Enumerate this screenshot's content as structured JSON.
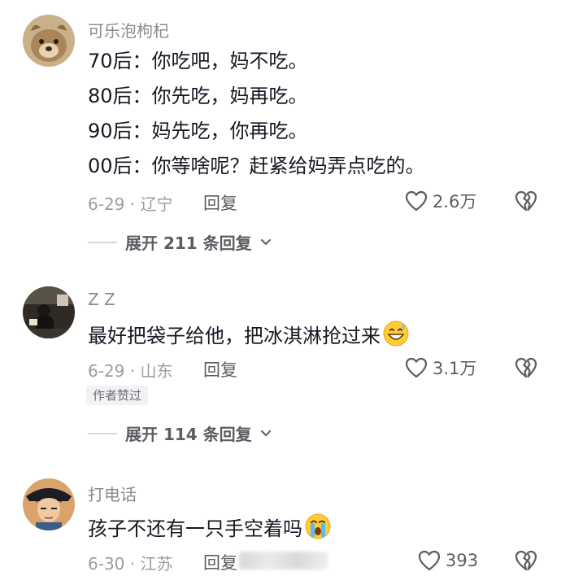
{
  "comments": [
    {
      "username": "可乐泡枸杞",
      "avatar_icon": "dog-photo-avatar",
      "lines": [
        "70后：你吃吧，妈不吃。",
        "80后：你先吃，妈再吃。",
        "90后：妈先吃，你再吃。",
        "00后：你等啥呢？赶紧给妈弄点吃的。"
      ],
      "date_location": "6-29 · 辽宁",
      "reply_label": "回复",
      "like_count": "2.6万",
      "expand_label": "展开 211 条回复"
    },
    {
      "username": "Z Z",
      "avatar_icon": "night-street-avatar",
      "text": "最好把袋子给他，把冰淇淋抢过来",
      "emoji": "grinning-sweat-emoji",
      "date_location": "6-29 · 山东",
      "reply_label": "回复",
      "like_count": "3.1万",
      "badge": "作者赞过",
      "expand_label": "展开 114 条回复"
    },
    {
      "username": "打电话",
      "avatar_icon": "anime-character-avatar",
      "text": "孩子不还有一只手空着吗",
      "emoji": "crying-face-emoji",
      "date_location": "6-30 · 江苏",
      "reply_label": "回复",
      "like_count": "393"
    }
  ],
  "icons": {
    "like": "heart-outline-icon",
    "dislike": "broken-heart-icon",
    "expand": "chevron-down-icon"
  },
  "colors": {
    "text": "#161823",
    "muted": "#8a8b91",
    "badge_bg": "#f2f2f4"
  }
}
